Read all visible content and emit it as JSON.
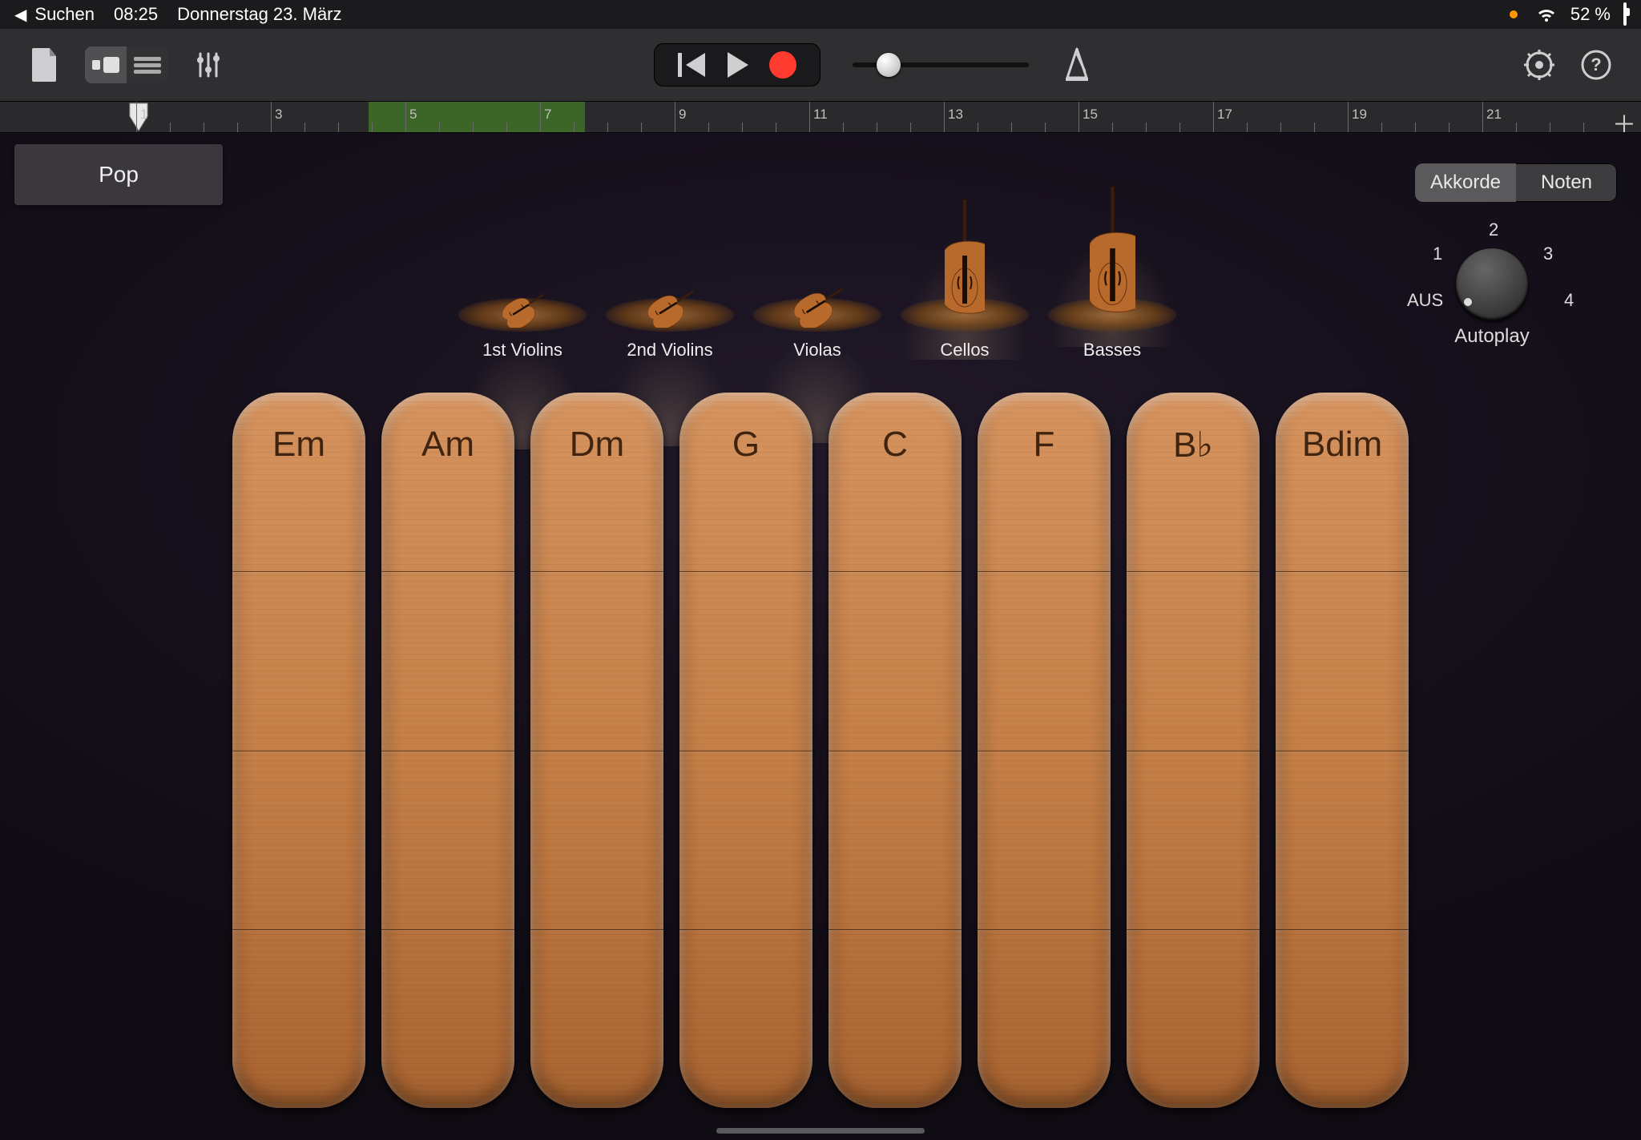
{
  "statusbar": {
    "back_app": "Suchen",
    "time": "08:25",
    "date": "Donnerstag 23. März",
    "battery_pct": "52 %"
  },
  "ruler": {
    "numbers": [
      "1",
      "3",
      "5",
      "7",
      "9",
      "11",
      "13",
      "15",
      "17",
      "19",
      "21"
    ],
    "green_start_bar": 4,
    "green_end_bar": 8
  },
  "preset": {
    "label": "Pop"
  },
  "mode": {
    "chords": "Akkorde",
    "notes": "Noten"
  },
  "autoplay": {
    "title": "Autoplay",
    "labels": {
      "off": "AUS",
      "1": "1",
      "2": "2",
      "3": "3",
      "4": "4"
    }
  },
  "instruments": [
    {
      "label": "1st Violins",
      "size": 0.6
    },
    {
      "label": "2nd Violins",
      "size": 0.65
    },
    {
      "label": "Violas",
      "size": 0.7
    },
    {
      "label": "Cellos",
      "size": 1.0
    },
    {
      "label": "Basses",
      "size": 1.15
    }
  ],
  "chords": [
    "Em",
    "Am",
    "Dm",
    "G",
    "C",
    "F",
    "B♭",
    "Bdim"
  ]
}
